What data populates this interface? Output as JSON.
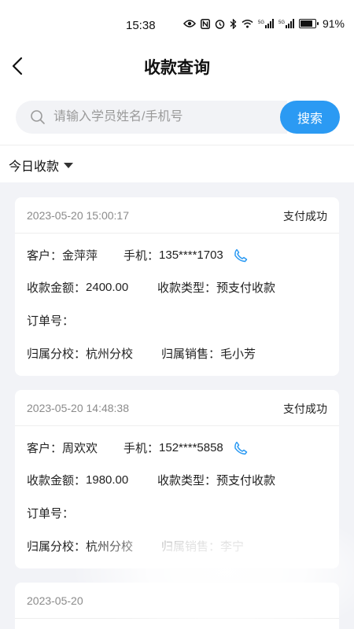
{
  "status_bar": {
    "time": "15:38",
    "signal_labels": [
      "5G",
      "5G"
    ],
    "battery_percent": 91,
    "battery_text": "91%"
  },
  "navbar": {
    "title": "收款查询",
    "back_icon": "chevron-left-icon"
  },
  "search": {
    "placeholder": "请输入学员姓名/手机号",
    "value": "",
    "button_label": "搜索"
  },
  "filter": {
    "selected": "今日收款"
  },
  "labels": {
    "customer": "客户：",
    "phone": "手机：",
    "amount": "收款金额：",
    "type": "收款类型：",
    "order": "订单号：",
    "school": "归属分校：",
    "sales": "归属销售："
  },
  "cards": [
    {
      "time": "2023-05-20 15:00:17",
      "status": "支付成功",
      "customer": "金萍萍",
      "phone": "135****1703",
      "amount": "2400.00",
      "type": "预支付收款",
      "order": "",
      "school": "杭州分校",
      "sales": "毛小芳"
    },
    {
      "time": "2023-05-20 14:48:38",
      "status": "支付成功",
      "customer": "周欢欢",
      "phone": "152****5858",
      "amount": "1980.00",
      "type": "预支付收款",
      "order": "",
      "school": "杭州分校",
      "sales": "李宁"
    },
    {
      "time": "2023-05-20"
    }
  ],
  "colors": {
    "accent": "#2b9af3",
    "background": "#f2f3f7",
    "phone_icon": "#2b9af3"
  }
}
